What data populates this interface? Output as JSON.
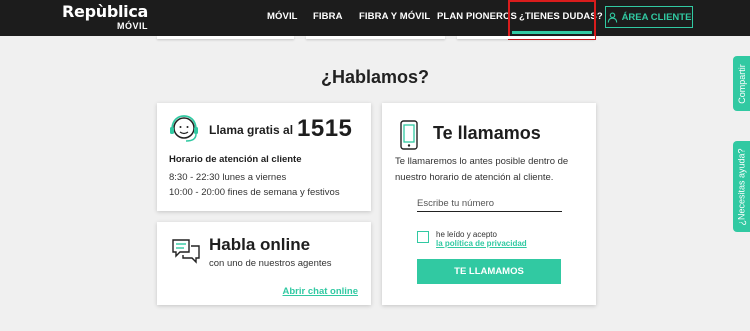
{
  "header": {
    "logo_main": "Repùblica",
    "logo_sub": "MÓVIL",
    "nav": [
      "MÓVIL",
      "FIBRA",
      "FIBRA Y MÓVIL",
      "PLAN PIONEROS",
      "¿TIENES DUDAS?"
    ],
    "area_cliente": "ÁREA CLIENTE"
  },
  "main": {
    "title": "¿Hablamos?",
    "call_card": {
      "label": "Llama gratis al",
      "number": "1515",
      "hours_title": "Horario de atención al cliente",
      "hours": [
        "8:30 - 22:30 lunes a viernes",
        "10:00 - 20:00 fines de semana y festivos"
      ]
    },
    "chat_card": {
      "title": "Habla online",
      "subtitle": "con uno de nuestros agentes",
      "link": "Abrir chat online"
    },
    "callback_card": {
      "title": "Te llamamos",
      "description": "Te llamaremos lo antes posible dentro de nuestro horario de atención al cliente.",
      "input_placeholder": "Escribe tu número",
      "accept_text": "he leído y acepto",
      "privacy_link": "la política de privacidad",
      "button": "TE LLAMAMOS"
    }
  },
  "side_tabs": [
    "Compartir",
    "¿Necesitas ayuda?"
  ],
  "colors": {
    "accent": "#31c9a2",
    "header_bg": "#1c1c1c",
    "highlight": "#d91c1c"
  }
}
